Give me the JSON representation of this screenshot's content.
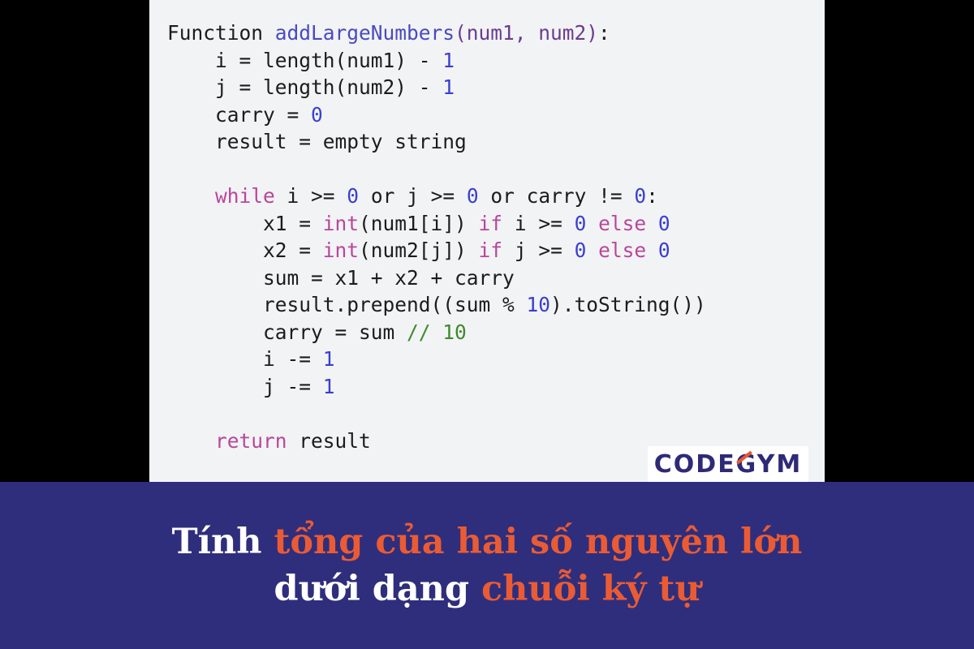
{
  "colors": {
    "background": "#000000",
    "code_panel": "#f2f3f5",
    "banner": "#2e2e7d",
    "accent_orange": "#ea5b34",
    "title_white": "#ffffff",
    "keyword": "#b8479a",
    "number": "#3a3fd0",
    "function_name": "#4a4ac0",
    "comment": "#3f8a2e"
  },
  "code": {
    "lines": [
      [
        {
          "t": "Function ",
          "c": "plain"
        },
        {
          "t": "addLargeNumbers",
          "c": "fn"
        },
        {
          "t": "(num1, num2)",
          "c": "param"
        },
        {
          "t": ":",
          "c": "plain"
        }
      ],
      [
        {
          "t": "    i = length(num1) - ",
          "c": "plain"
        },
        {
          "t": "1",
          "c": "num"
        }
      ],
      [
        {
          "t": "    j = length(num2) - ",
          "c": "plain"
        },
        {
          "t": "1",
          "c": "num"
        }
      ],
      [
        {
          "t": "    carry = ",
          "c": "plain"
        },
        {
          "t": "0",
          "c": "num"
        }
      ],
      [
        {
          "t": "    result = empty string",
          "c": "plain"
        }
      ],
      [
        {
          "t": "",
          "c": "plain"
        }
      ],
      [
        {
          "t": "    ",
          "c": "plain"
        },
        {
          "t": "while",
          "c": "kw"
        },
        {
          "t": " i >= ",
          "c": "plain"
        },
        {
          "t": "0",
          "c": "num"
        },
        {
          "t": " or j >= ",
          "c": "plain"
        },
        {
          "t": "0",
          "c": "num"
        },
        {
          "t": " or carry != ",
          "c": "plain"
        },
        {
          "t": "0",
          "c": "num"
        },
        {
          "t": ":",
          "c": "plain"
        }
      ],
      [
        {
          "t": "        x1 = ",
          "c": "plain"
        },
        {
          "t": "int",
          "c": "kw"
        },
        {
          "t": "(num1[i]) ",
          "c": "plain"
        },
        {
          "t": "if",
          "c": "kw"
        },
        {
          "t": " i >= ",
          "c": "plain"
        },
        {
          "t": "0",
          "c": "num"
        },
        {
          "t": " ",
          "c": "plain"
        },
        {
          "t": "else",
          "c": "kw"
        },
        {
          "t": " ",
          "c": "plain"
        },
        {
          "t": "0",
          "c": "num"
        }
      ],
      [
        {
          "t": "        x2 = ",
          "c": "plain"
        },
        {
          "t": "int",
          "c": "kw"
        },
        {
          "t": "(num2[j]) ",
          "c": "plain"
        },
        {
          "t": "if",
          "c": "kw"
        },
        {
          "t": " j >= ",
          "c": "plain"
        },
        {
          "t": "0",
          "c": "num"
        },
        {
          "t": " ",
          "c": "plain"
        },
        {
          "t": "else",
          "c": "kw"
        },
        {
          "t": " ",
          "c": "plain"
        },
        {
          "t": "0",
          "c": "num"
        }
      ],
      [
        {
          "t": "        sum = x1 + x2 + carry",
          "c": "plain"
        }
      ],
      [
        {
          "t": "        result.prepend((sum % ",
          "c": "plain"
        },
        {
          "t": "10",
          "c": "num"
        },
        {
          "t": ").toString())",
          "c": "plain"
        }
      ],
      [
        {
          "t": "        carry = sum ",
          "c": "plain"
        },
        {
          "t": "// 10",
          "c": "comment"
        }
      ],
      [
        {
          "t": "        i -= ",
          "c": "plain"
        },
        {
          "t": "1",
          "c": "num"
        }
      ],
      [
        {
          "t": "        j -= ",
          "c": "plain"
        },
        {
          "t": "1",
          "c": "num"
        }
      ],
      [
        {
          "t": "",
          "c": "plain"
        }
      ],
      [
        {
          "t": "    ",
          "c": "plain"
        },
        {
          "t": "return",
          "c": "kw"
        },
        {
          "t": " result",
          "c": "plain"
        }
      ]
    ]
  },
  "logo": {
    "text": "CODEGYM"
  },
  "banner": {
    "line1": [
      {
        "text": "Tính ",
        "color": "white"
      },
      {
        "text": "tổng của hai số nguyên lớn",
        "color": "orange"
      }
    ],
    "line2": [
      {
        "text": "dưới dạng ",
        "color": "white"
      },
      {
        "text": "chuỗi ký tự",
        "color": "orange"
      }
    ]
  }
}
